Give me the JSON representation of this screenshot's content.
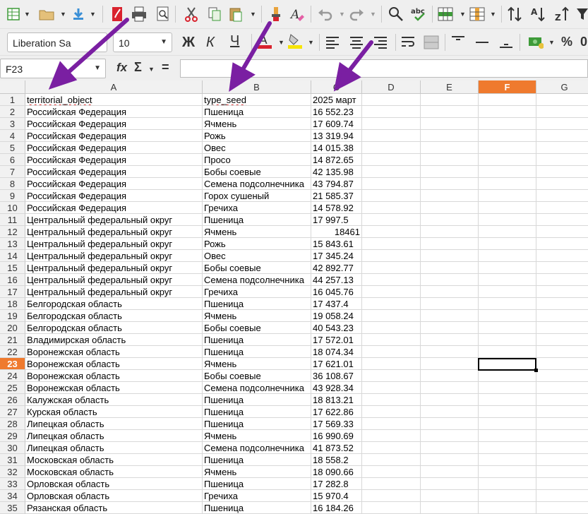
{
  "toolbar": {
    "font_name": "Liberation Sa",
    "font_size": "10",
    "bold_label": "Ж",
    "italic_label": "К",
    "underline_label": "Ч",
    "percent_label": "%",
    "accent_red": "#d9232e",
    "accent_yellow": "#f7e400",
    "accent_green": "#3e9b39"
  },
  "formula_bar": {
    "cell_ref": "F23",
    "fx_label": "fx",
    "sum_label": "Σ",
    "eq_label": "=",
    "content": ""
  },
  "columns": [
    "A",
    "B",
    "C",
    "D",
    "E",
    "F",
    "G"
  ],
  "selected_column": "F",
  "selected_row": "23",
  "rows": [
    {
      "n": "1",
      "a": "territorial_object",
      "b": "type_seed",
      "c": "2025 март"
    },
    {
      "n": "2",
      "a": "Российская Федерация",
      "b": "Пшеница",
      "c": "16 552.23"
    },
    {
      "n": "3",
      "a": "Российская Федерация",
      "b": "Ячмень",
      "c": "17 609.74"
    },
    {
      "n": "4",
      "a": "Российская Федерация",
      "b": "Рожь",
      "c": "13 319.94"
    },
    {
      "n": "5",
      "a": "Российская Федерация",
      "b": "Овес",
      "c": "14 015.38"
    },
    {
      "n": "6",
      "a": "Российская Федерация",
      "b": "Просо",
      "c": "14 872.65"
    },
    {
      "n": "7",
      "a": "Российская Федерация",
      "b": "Бобы соевые",
      "c": "42 135.98"
    },
    {
      "n": "8",
      "a": "Российская Федерация",
      "b": "Семена подсолнечника",
      "c": "43 794.87"
    },
    {
      "n": "9",
      "a": "Российская Федерация",
      "b": "Горох сушеный",
      "c": "21 585.37"
    },
    {
      "n": "10",
      "a": "Российская Федерация",
      "b": "Гречиха",
      "c": "14 578.92"
    },
    {
      "n": "11",
      "a": "Центральный федеральный округ",
      "b": "Пшеница",
      "c": "17 997.5"
    },
    {
      "n": "12",
      "a": "Центральный федеральный округ",
      "b": "Ячмень",
      "c": "18461"
    },
    {
      "n": "13",
      "a": "Центральный федеральный округ",
      "b": "Рожь",
      "c": "15 843.61"
    },
    {
      "n": "14",
      "a": "Центральный федеральный округ",
      "b": "Овес",
      "c": "17 345.24"
    },
    {
      "n": "15",
      "a": "Центральный федеральный округ",
      "b": "Бобы соевые",
      "c": "42 892.77"
    },
    {
      "n": "16",
      "a": "Центральный федеральный округ",
      "b": "Семена подсолнечника",
      "c": "44 257.13"
    },
    {
      "n": "17",
      "a": "Центральный федеральный округ",
      "b": "Гречиха",
      "c": "16 045.76"
    },
    {
      "n": "18",
      "a": "Белгородская область",
      "b": "Пшеница",
      "c": "17 437.4"
    },
    {
      "n": "19",
      "a": "Белгородская область",
      "b": "Ячмень",
      "c": "19 058.24"
    },
    {
      "n": "20",
      "a": "Белгородская область",
      "b": "Бобы соевые",
      "c": "40 543.23"
    },
    {
      "n": "21",
      "a": "Владимирская область",
      "b": "Пшеница",
      "c": "17 572.01"
    },
    {
      "n": "22",
      "a": "Воронежская область",
      "b": "Пшеница",
      "c": "18 074.34"
    },
    {
      "n": "23",
      "a": "Воронежская область",
      "b": "Ячмень",
      "c": "17 621.01"
    },
    {
      "n": "24",
      "a": "Воронежская область",
      "b": "Бобы соевые",
      "c": "36 108.67"
    },
    {
      "n": "25",
      "a": "Воронежская область",
      "b": "Семена подсолнечника",
      "c": "43 928.34"
    },
    {
      "n": "26",
      "a": "Калужская область",
      "b": "Пшеница",
      "c": "18 813.21"
    },
    {
      "n": "27",
      "a": "Курская область",
      "b": "Пшеница",
      "c": "17 622.86"
    },
    {
      "n": "28",
      "a": "Липецкая область",
      "b": "Пшеница",
      "c": "17 569.33"
    },
    {
      "n": "29",
      "a": "Липецкая область",
      "b": "Ячмень",
      "c": "16 990.69"
    },
    {
      "n": "30",
      "a": "Липецкая область",
      "b": "Семена подсолнечника",
      "c": "41 873.52"
    },
    {
      "n": "31",
      "a": "Московская область",
      "b": "Пшеница",
      "c": "18 558.2"
    },
    {
      "n": "32",
      "a": "Московская область",
      "b": "Ячмень",
      "c": "18 090.66"
    },
    {
      "n": "33",
      "a": "Орловская область",
      "b": "Пшеница",
      "c": "17 282.8"
    },
    {
      "n": "34",
      "a": "Орловская область",
      "b": "Гречиха",
      "c": "15 970.4"
    },
    {
      "n": "35",
      "a": "Рязанская область",
      "b": "Пшеница",
      "c": "16 184.26"
    }
  ],
  "numeric_right_aligned_rows": [
    "12"
  ],
  "annotation_arrow_color": "#7a1fa2"
}
